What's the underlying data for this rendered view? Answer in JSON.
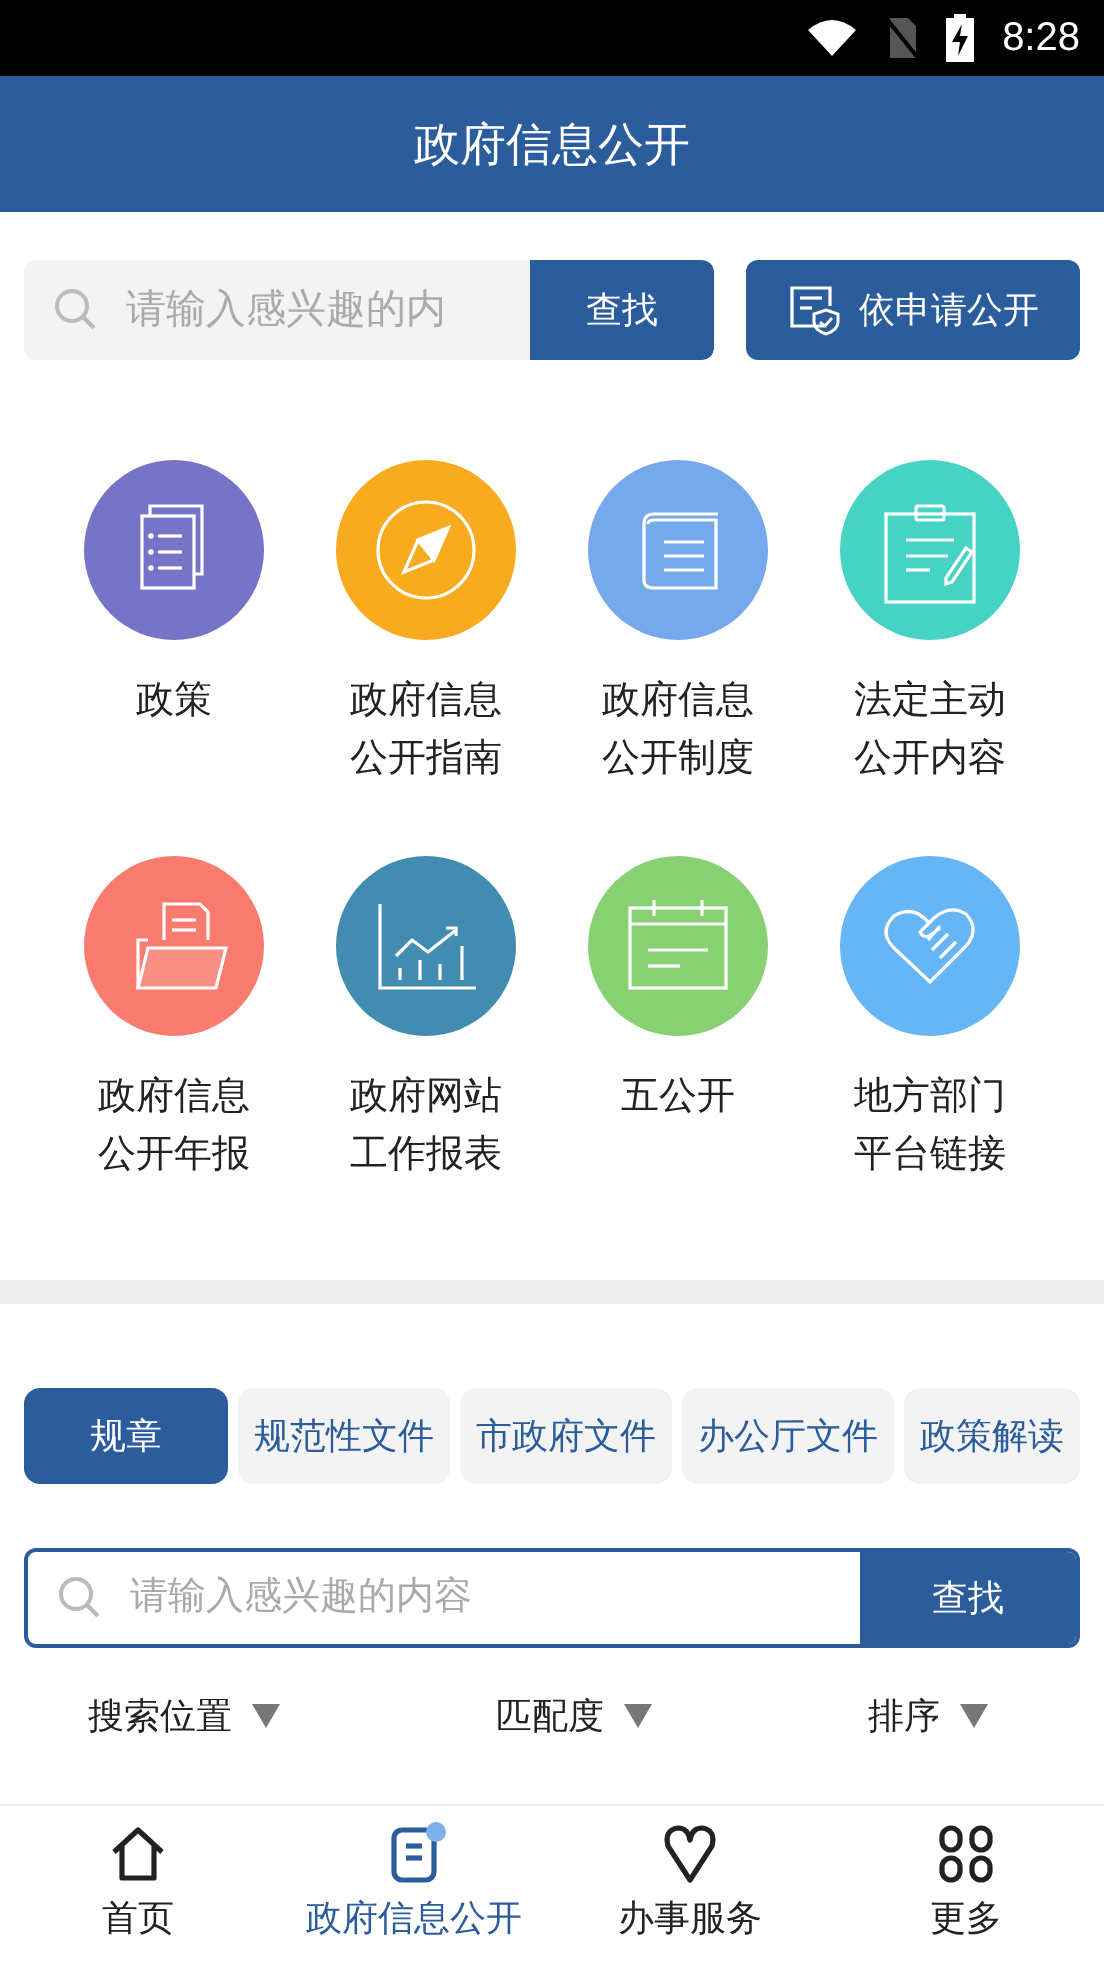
{
  "status_bar": {
    "time": "8:28"
  },
  "header": {
    "title": "政府信息公开"
  },
  "top_search": {
    "placeholder": "请输入感兴趣的内",
    "button": "查找"
  },
  "apply_button": {
    "label": "依申请公开"
  },
  "tiles": [
    {
      "label": "政策",
      "kind": "docs",
      "color": "#7574c6"
    },
    {
      "label": "政府信息公开指南",
      "kind": "compass",
      "color": "#f9ab1f"
    },
    {
      "label": "政府信息公开制度",
      "kind": "book",
      "color": "#75a9ec"
    },
    {
      "label": "法定主动公开内容",
      "kind": "clipboard",
      "color": "#46d3c4"
    },
    {
      "label": "政府信息公开年报",
      "kind": "folder",
      "color": "#f87b6e"
    },
    {
      "label": "政府网站工作报表",
      "kind": "chart",
      "color": "#418cb0"
    },
    {
      "label": "五公开",
      "kind": "calendar",
      "color": "#88d173"
    },
    {
      "label": "地方部门平台链接",
      "kind": "handshake",
      "color": "#66b5f5"
    }
  ],
  "tabs": [
    {
      "label": "规章",
      "selected": true
    },
    {
      "label": "规范性文件",
      "selected": false
    },
    {
      "label": "市政府文件",
      "selected": false
    },
    {
      "label": "办公厅文件",
      "selected": false
    },
    {
      "label": "政策解读",
      "selected": false
    }
  ],
  "search": {
    "placeholder": "请输入感兴趣的内容",
    "button": "查找"
  },
  "filters": [
    "搜索位置",
    "匹配度",
    "排序"
  ],
  "nav": [
    {
      "label": "首页",
      "kind": "home",
      "selected": false,
      "badge": false
    },
    {
      "label": "政府信息公开",
      "kind": "doc",
      "selected": true,
      "badge": true
    },
    {
      "label": "办事服务",
      "kind": "heart",
      "selected": false,
      "badge": false
    },
    {
      "label": "更多",
      "kind": "grid",
      "selected": false,
      "badge": false
    }
  ]
}
